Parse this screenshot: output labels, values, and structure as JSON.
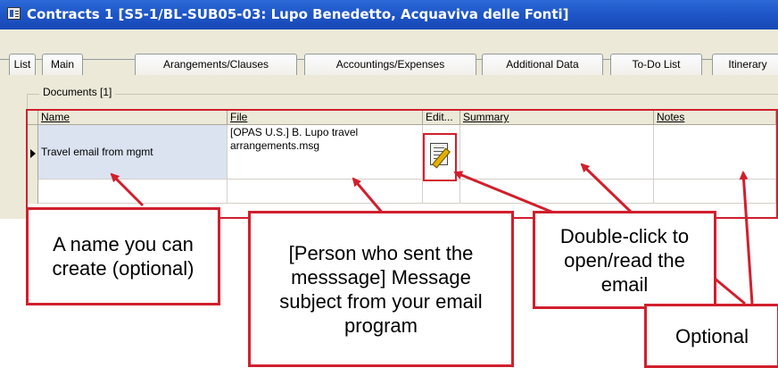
{
  "window": {
    "title": "Contracts  1 [S5-1/BL-SUB05-03: Lupo Benedetto, Acquaviva delle Fonti]"
  },
  "tabs": [
    {
      "label": "List"
    },
    {
      "label": "Main"
    },
    {
      "label": "Arangements/Clauses"
    },
    {
      "label": "Accountings/Expenses"
    },
    {
      "label": "Additional Data"
    },
    {
      "label": "To-Do List"
    },
    {
      "label": "Itinerary"
    }
  ],
  "documents": {
    "group_label": "Documents  [1]",
    "columns": [
      {
        "label": "Name"
      },
      {
        "label": "File"
      },
      {
        "label": "Edit..."
      },
      {
        "label": "Summary"
      },
      {
        "label": "Notes"
      }
    ],
    "rows": [
      {
        "name": "Travel email from mgmt",
        "file": "[OPAS U.S.] B. Lupo travel arrangements.msg",
        "edit_icon": "document-edit-icon",
        "summary": "",
        "notes": ""
      }
    ]
  },
  "callouts": {
    "name": "A name you can create (optional)",
    "file": "[Person who sent the messsage] Message subject from your email program",
    "edit": "Double-click to open/read the email",
    "optional": "Optional"
  },
  "colors": {
    "titlebar": "#1f57c9",
    "window_bg": "#ece9d8",
    "highlight": "#d11f2d",
    "selected_cell": "#dbe3f1"
  }
}
